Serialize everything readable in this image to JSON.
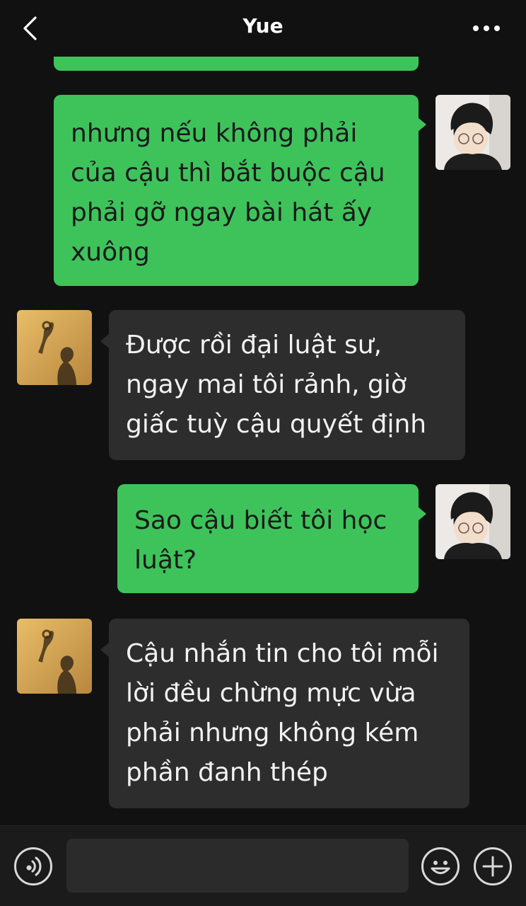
{
  "header": {
    "title": "Yue",
    "back_icon": "chevron-left-icon",
    "more_icon": "more-dots-icon"
  },
  "messages": [
    {
      "sender": "me",
      "text": ""
    },
    {
      "sender": "me",
      "text": "nhưng nếu không phải của cậu thì bắt buộc cậu phải gỡ ngay bài hát ấy xuông"
    },
    {
      "sender": "other",
      "text": "Được rồi đại luật sư, ngay mai tôi rảnh, giờ giấc tuỳ cậu quyết định"
    },
    {
      "sender": "me",
      "text": "Sao cậu biết tôi học luật?"
    },
    {
      "sender": "other",
      "text": "Cậu nhắn tin cho tôi mỗi lời đều chừng mực vừa phải nhưng không kém phần đanh thép"
    }
  ],
  "input_bar": {
    "voice_icon": "voice-icon",
    "emoji_icon": "emoji-icon",
    "add_icon": "plus-icon",
    "message_value": ""
  },
  "colors": {
    "background": "#111111",
    "my_bubble": "#3ec35b",
    "their_bubble": "#2d2d2d"
  }
}
